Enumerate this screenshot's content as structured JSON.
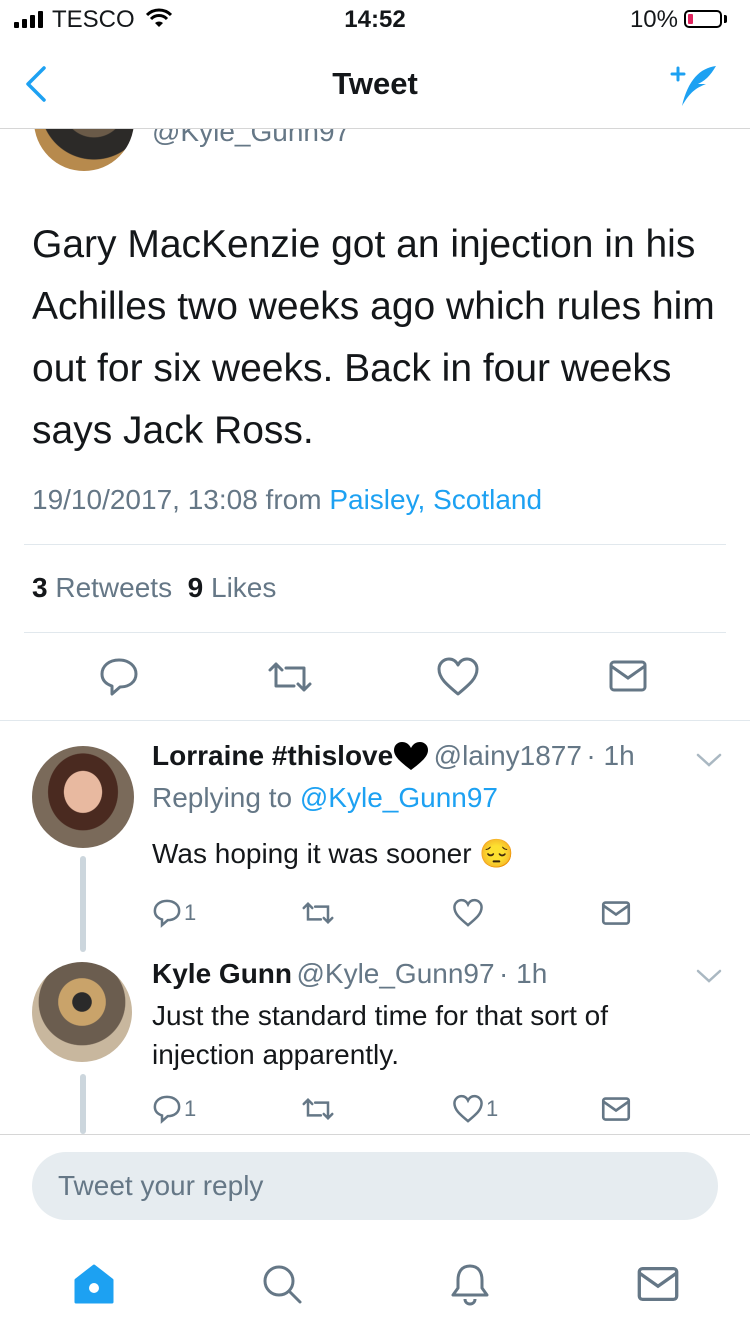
{
  "status_bar": {
    "carrier": "TESCO",
    "time": "14:52",
    "battery": "10%"
  },
  "nav": {
    "title": "Tweet"
  },
  "main_tweet": {
    "handle": "@Kyle_Gunn97",
    "text": "Gary MacKenzie got an injection in his Achilles two weeks ago which rules him out for six weeks. Back in four weeks says Jack Ross.",
    "timestamp": "19/10/2017, 13:08 from",
    "location": "Paisley, Scotland",
    "retweets": "3",
    "retweets_label": "Retweets",
    "likes": "9",
    "likes_label": "Likes"
  },
  "replies": [
    {
      "name": "Lorraine #thislove",
      "handle": "@lainy1877",
      "time": "· 1h",
      "replying_prefix": "Replying to",
      "replying_to": "@Kyle_Gunn97",
      "text": "Was hoping it was sooner",
      "emoji": "😔",
      "reply_count": "1",
      "like_count": ""
    },
    {
      "name": "Kyle Gunn",
      "handle": "@Kyle_Gunn97",
      "time": "· 1h",
      "text": "Just the standard time for that sort of injection apparently.",
      "reply_count": "1",
      "like_count": "1"
    }
  ],
  "reply_input": {
    "placeholder": "Tweet your reply"
  },
  "colors": {
    "accent": "#1da1f2",
    "text": "#14171a",
    "secondary": "#657786",
    "battery_low": "#e0245e"
  },
  "tabs": [
    "home-icon",
    "search-icon",
    "notifications-icon",
    "messages-icon"
  ]
}
